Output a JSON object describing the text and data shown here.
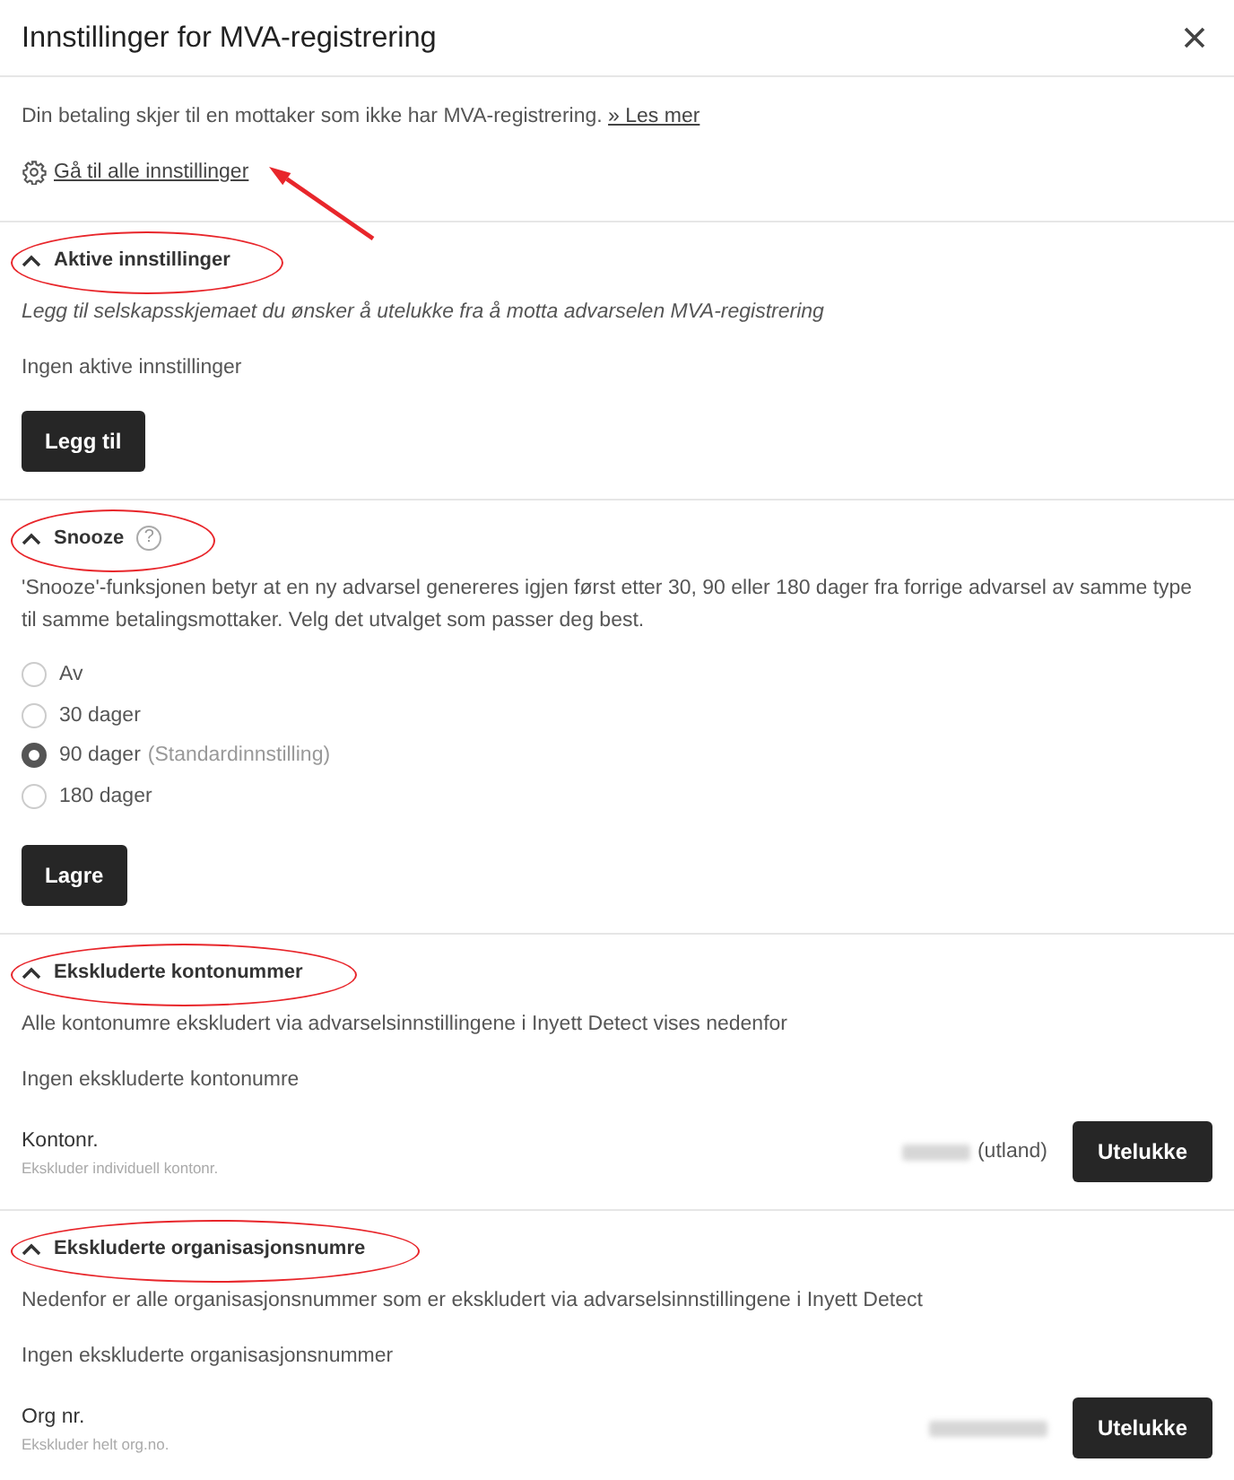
{
  "dialog": {
    "title": "Innstillinger for MVA-registrering"
  },
  "intro": {
    "text": "Din betaling skjer til en mottaker som ikke har MVA-registrering.",
    "link": "» Les mer",
    "settings_link": "Gå til alle innstillinger",
    "arrow": true
  },
  "sections": [
    {
      "kind": "add",
      "title": "Aktive innstillinger",
      "expanded": true,
      "circled": true,
      "description": "Legg til selskapsskjemaet du ønsker å utelukke fra å motta advarselen MVA-registrering",
      "empty_text": "Ingen aktive innstillinger",
      "button": "Legg til"
    },
    {
      "kind": "snooze",
      "title": "Snooze",
      "help": "?",
      "expanded": true,
      "circled": true,
      "description": "'Snooze'-funksjonen betyr at en ny advarsel genereres igjen først etter 30, 90 eller 180 dager fra forrige advarsel av samme type til samme betalingsmottaker. Velg det utvalget som passer deg best.",
      "options": [
        {
          "label": "Av",
          "selected": false
        },
        {
          "label": "30 dager",
          "selected": false
        },
        {
          "label": "90 dager",
          "note": "(Standardinnstilling)",
          "selected": true
        },
        {
          "label": "180 dager",
          "selected": false
        }
      ],
      "button": "Lagre"
    },
    {
      "kind": "exclude",
      "title": "Ekskluderte kontonummer",
      "expanded": true,
      "circled": true,
      "description": "Alle kontonumre ekskludert via advarselsinnstillingene i Inyett Detect vises nedenfor",
      "empty_text": "Ingen ekskluderte kontonumre",
      "field": {
        "label": "Kontonr.",
        "sublabel": "Ekskluder individuell kontonr.",
        "redacted": true,
        "suffix": "(utland)"
      },
      "button": "Utelukke"
    },
    {
      "kind": "exclude",
      "title": "Ekskluderte organisasjonsnumre",
      "expanded": true,
      "circled": true,
      "description": "Nedenfor er alle organisasjonsnummer som er ekskludert via advarselsinnstillingene i Inyett Detect",
      "empty_text": "Ingen ekskluderte organisasjonsnummer",
      "field": {
        "label": "Org nr.",
        "sublabel": "Ekskluder helt org.no.",
        "redacted": true
      },
      "button": "Utelukke"
    }
  ]
}
